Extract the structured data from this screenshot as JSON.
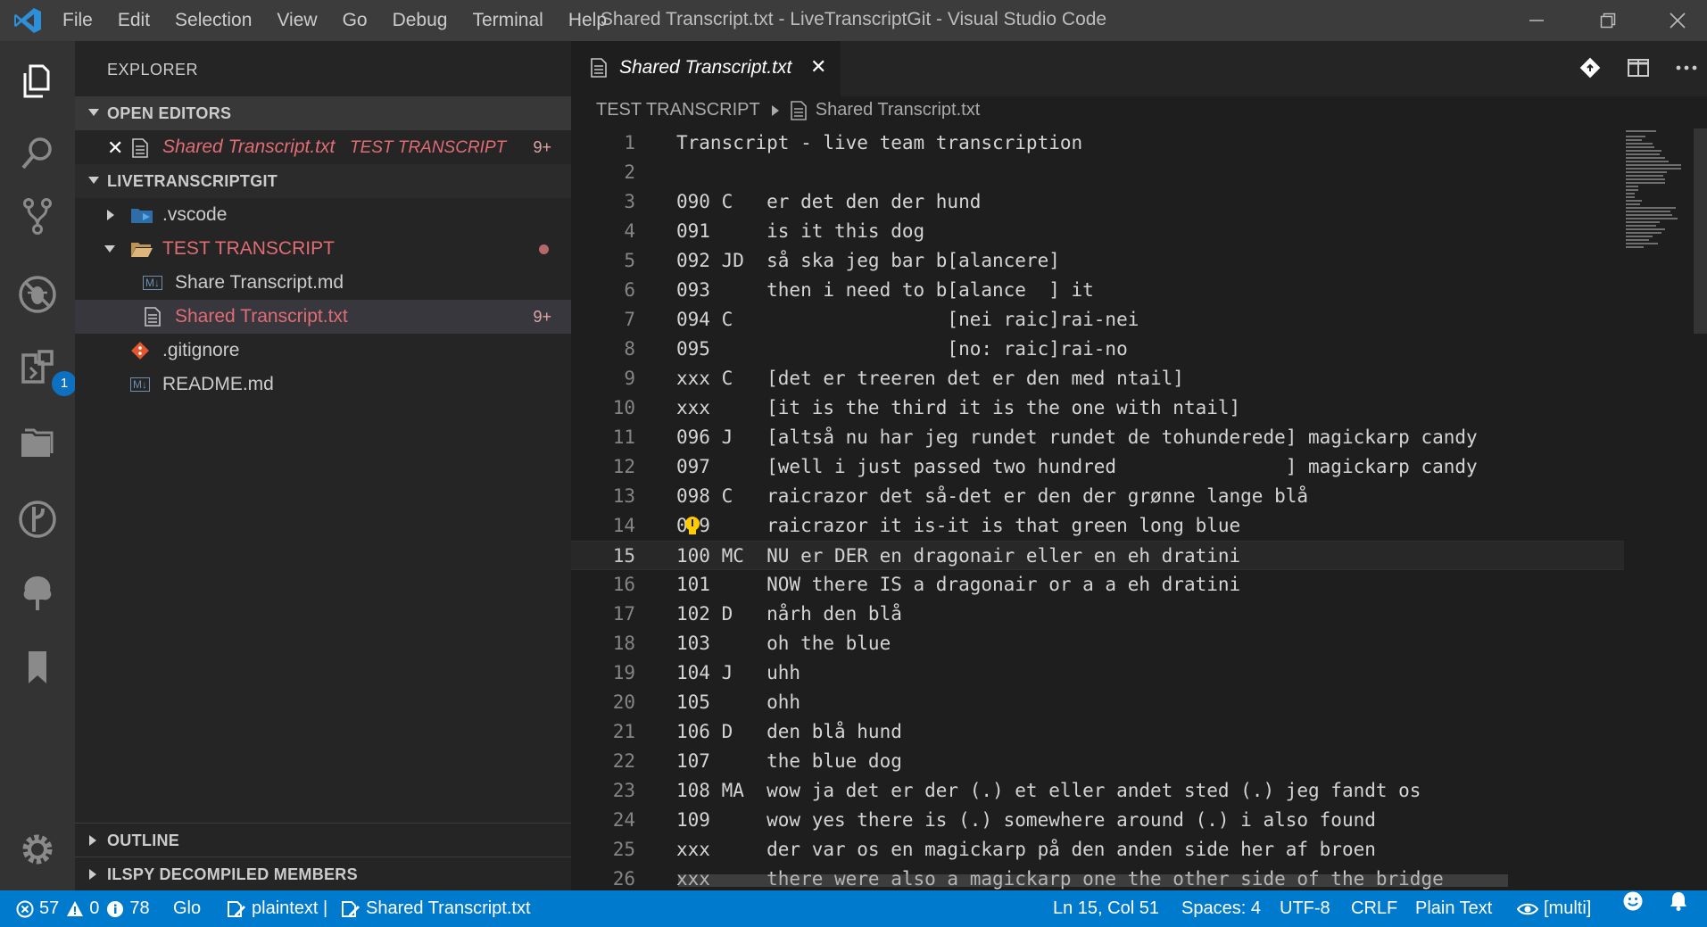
{
  "window": {
    "title": "Shared Transcript.txt - LiveTranscriptGit - Visual Studio Code",
    "menu": [
      "File",
      "Edit",
      "Selection",
      "View",
      "Go",
      "Debug",
      "Terminal",
      "Help"
    ]
  },
  "activity_bar": {
    "items": [
      "explorer-icon",
      "search-icon",
      "source-control-icon",
      "debug-icon",
      "extensions-icon",
      "folders-icon",
      "git-lens-icon",
      "tree-icon",
      "bookmark-icon"
    ],
    "extensions_badge": "1",
    "settings_icon": "gear-icon"
  },
  "sidebar": {
    "title": "EXPLORER",
    "open_editors": {
      "label": "OPEN EDITORS",
      "items": [
        {
          "name": "Shared Transcript.txt",
          "folder": "TEST TRANSCRIPT",
          "count": "9+"
        }
      ]
    },
    "workspace": {
      "label": "LIVETRANSCRIPTGIT",
      "items": [
        {
          "name": ".vscode"
        },
        {
          "name": "TEST TRANSCRIPT"
        },
        {
          "name": "Share Transcript.md",
          "icon_label": "M↓"
        },
        {
          "name": "Shared Transcript.txt",
          "count": "9+"
        },
        {
          "name": ".gitignore"
        },
        {
          "name": "README.md",
          "icon_label": "M↓"
        }
      ]
    },
    "outline": {
      "label": "OUTLINE"
    },
    "ilspy": {
      "label": "ILSPY DECOMPILED MEMBERS"
    }
  },
  "editor": {
    "tab": {
      "name": "Shared Transcript.txt",
      "close": "✕"
    },
    "breadcrumb": {
      "folder": "TEST TRANSCRIPT",
      "file": "Shared Transcript.txt"
    },
    "current_line": 15,
    "lines": [
      {
        "n": "1",
        "t": "Transcript - live team transcription"
      },
      {
        "n": "2",
        "t": ""
      },
      {
        "n": "3",
        "t": "090 C   er det den der hund"
      },
      {
        "n": "4",
        "t": "091     is it this dog"
      },
      {
        "n": "5",
        "t": "092 JD  så ska jeg bar b[alancere]"
      },
      {
        "n": "6",
        "t": "093     then i need to b[alance  ] it"
      },
      {
        "n": "7",
        "t": "094 C                   [nei raic]rai-nei"
      },
      {
        "n": "8",
        "t": "095                     [no: raic]rai-no"
      },
      {
        "n": "9",
        "t": "xxx C   [det er treeren det er den med ntail]"
      },
      {
        "n": "10",
        "t": "xxx     [it is the third it is the one with ntail]"
      },
      {
        "n": "11",
        "t": "096 J   [altså nu har jeg rundet rundet de tohunderede] magickarp candy"
      },
      {
        "n": "12",
        "t": "097     [well i just passed two hundred               ] magickarp candy"
      },
      {
        "n": "13",
        "t": "098 C   raicrazor det så-det er den der grønne lange blå"
      },
      {
        "n": "14",
        "t": "0 9     raicrazor it is-it is that green long blue"
      },
      {
        "n": "15",
        "t": "100 MC  NU er DER en dragonair eller en eh dratini"
      },
      {
        "n": "16",
        "t": "101     NOW there IS a dragonair or a a eh dratini"
      },
      {
        "n": "17",
        "t": "102 D   nårh den blå"
      },
      {
        "n": "18",
        "t": "103     oh the blue"
      },
      {
        "n": "19",
        "t": "104 J   uhh"
      },
      {
        "n": "20",
        "t": "105     ohh"
      },
      {
        "n": "21",
        "t": "106 D   den blå hund"
      },
      {
        "n": "22",
        "t": "107     the blue dog"
      },
      {
        "n": "23",
        "t": "108 MA  wow ja det er der (.) et eller andet sted (.) jeg fandt os"
      },
      {
        "n": "24",
        "t": "109     wow yes there is (.) somewhere around (.) i also found"
      },
      {
        "n": "25",
        "t": "xxx     der var os en magickarp på den anden side her af broen"
      },
      {
        "n": "26",
        "t": "xxx     there were also a magickarp one the other side of the bridge"
      }
    ]
  },
  "status_bar": {
    "errors": "57",
    "warnings": "0",
    "infos": "78",
    "glo": "Glo",
    "plaintext": "plaintext |",
    "file": "Shared Transcript.txt",
    "position": "Ln 15, Col 51",
    "spaces": "Spaces: 4",
    "encoding": "UTF-8",
    "eol": "CRLF",
    "language": "Plain Text",
    "multi": "[multi]"
  },
  "colors": {
    "accent": "#007acc",
    "modified": "#e06c75",
    "sidebar": "#252526",
    "editor": "#1e1e1e"
  }
}
